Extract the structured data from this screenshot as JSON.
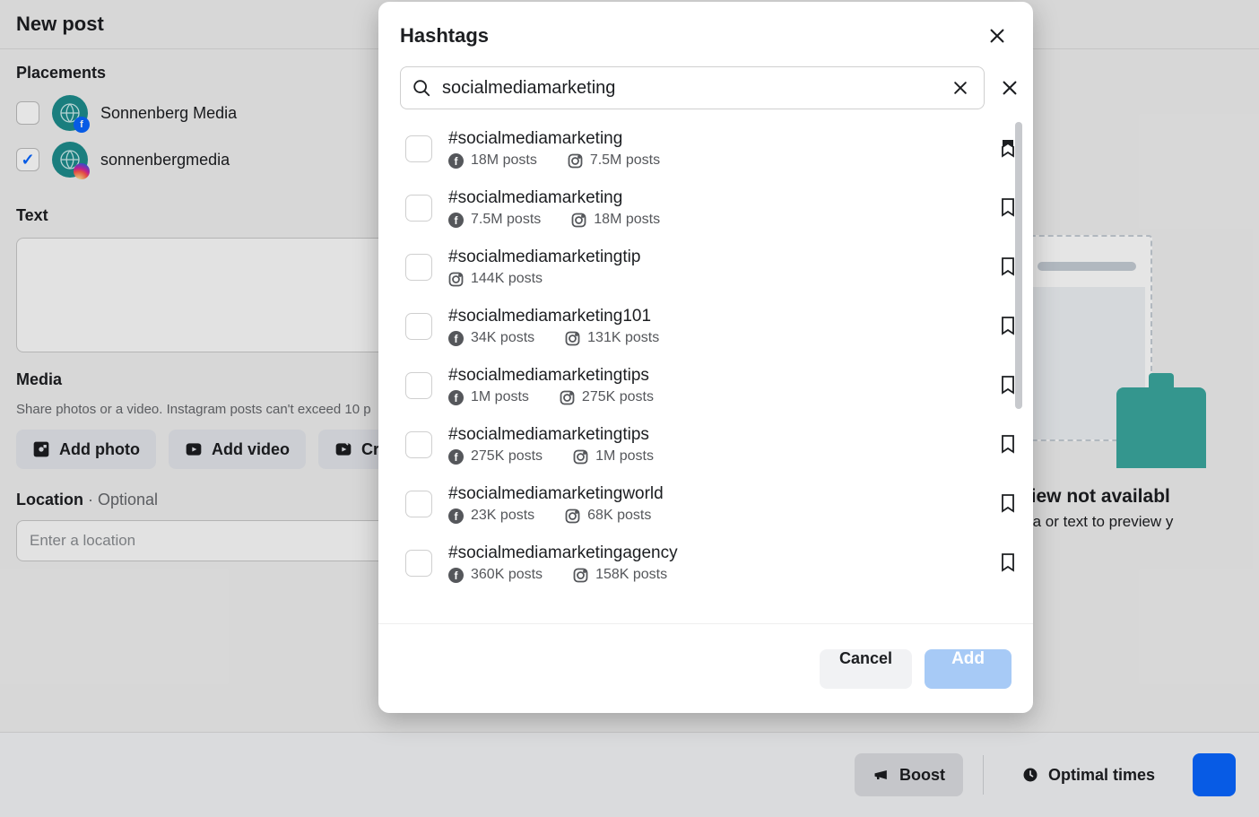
{
  "page": {
    "title": "New post"
  },
  "placements": {
    "label": "Placements",
    "items": [
      {
        "name": "Sonnenberg Media",
        "checked": false,
        "network": "fb"
      },
      {
        "name": "sonnenbergmedia",
        "checked": true,
        "network": "ig"
      }
    ]
  },
  "text_section": {
    "label": "Text"
  },
  "media_section": {
    "label": "Media",
    "sub": "Share photos or a video. Instagram posts can't exceed 10 p",
    "buttons": {
      "photo": "Add photo",
      "video": "Add video",
      "reel": "Cre"
    }
  },
  "location_section": {
    "label": "Location",
    "optional": " · Optional",
    "placeholder": "Enter a location"
  },
  "preview": {
    "title": "Preview not availabl",
    "sub": "d media or text to preview y"
  },
  "bottom_bar": {
    "boost": "Boost",
    "optimal": "Optimal times"
  },
  "modal": {
    "title": "Hashtags",
    "search_value": "socialmediamarketing",
    "cancel": "Cancel",
    "add": "Add",
    "results": [
      {
        "tag": "#socialmediamarketing",
        "fb": "18M posts",
        "ig": "7.5M posts",
        "bookmarked": true
      },
      {
        "tag": "#socialmediamarketing",
        "fb": "7.5M posts",
        "ig": "18M posts",
        "bookmarked": false
      },
      {
        "tag": "#socialmediamarketingtip",
        "fb": null,
        "ig": "144K posts",
        "bookmarked": false
      },
      {
        "tag": "#socialmediamarketing101",
        "fb": "34K posts",
        "ig": "131K posts",
        "bookmarked": false
      },
      {
        "tag": "#socialmediamarketingtips",
        "fb": "1M posts",
        "ig": "275K posts",
        "bookmarked": false
      },
      {
        "tag": "#socialmediamarketingtips",
        "fb": "275K posts",
        "ig": "1M posts",
        "bookmarked": false
      },
      {
        "tag": "#socialmediamarketingworld",
        "fb": "23K posts",
        "ig": "68K posts",
        "bookmarked": false
      },
      {
        "tag": "#socialmediamarketingagency",
        "fb": "360K posts",
        "ig": "158K posts",
        "bookmarked": false
      }
    ]
  }
}
